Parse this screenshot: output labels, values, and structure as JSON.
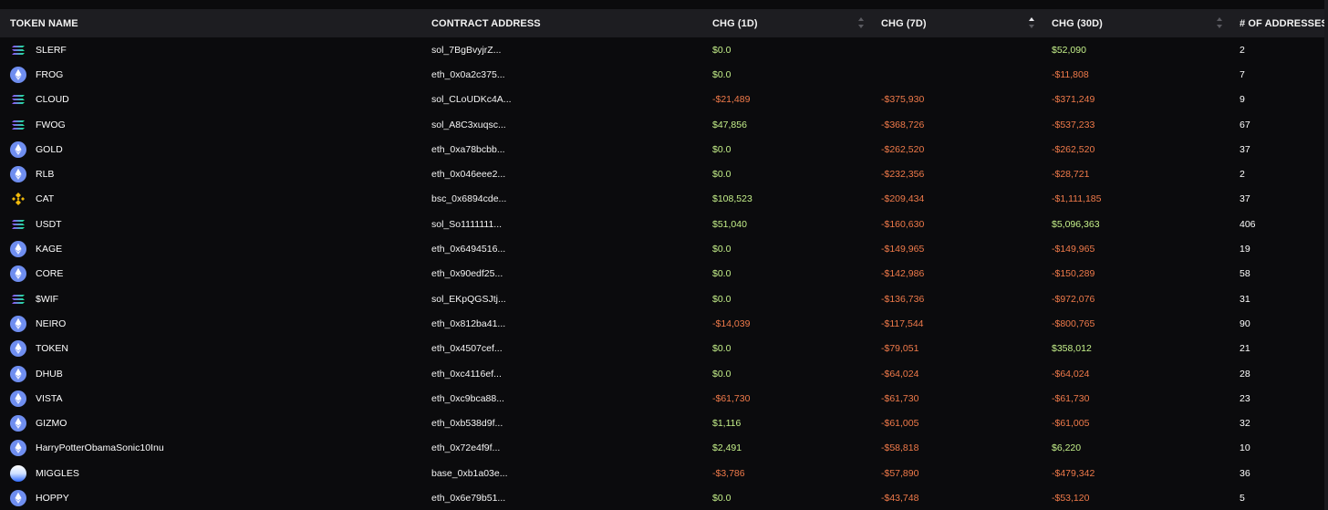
{
  "colors": {
    "background": "#0b0b0d",
    "header_bg": "#1d1d21",
    "positive": "#c5f08a",
    "negative": "#f07a4a",
    "eth_icon": "#6f8ef0",
    "bsc_icon": "#f0b90b"
  },
  "table": {
    "headers": {
      "token_name": "TOKEN NAME",
      "contract_address": "CONTRACT ADDRESS",
      "chg_1d": "CHG (1D)",
      "chg_7d": "CHG (7D)",
      "chg_30d": "CHG (30D)",
      "num_addresses": "# OF ADDRESSES"
    },
    "sort_state": {
      "chg_1d": "none",
      "chg_7d": "ascending",
      "chg_30d": "none"
    },
    "rows": [
      {
        "chain": "sol",
        "icon": "solana-icon",
        "token": "SLERF",
        "address": "sol_7BgBvyjrZ...",
        "chg_1d": "$0.0",
        "d1": "pos",
        "chg_7d": "",
        "d7": "pos",
        "chg_30d": "$52,090",
        "d30": "pos",
        "addresses": "2"
      },
      {
        "chain": "eth",
        "icon": "ethereum-icon",
        "token": "FROG",
        "address": "eth_0x0a2c375...",
        "chg_1d": "$0.0",
        "d1": "pos",
        "chg_7d": "",
        "d7": "pos",
        "chg_30d": "-$11,808",
        "d30": "neg",
        "addresses": "7"
      },
      {
        "chain": "sol",
        "icon": "solana-icon",
        "token": "CLOUD",
        "address": "sol_CLoUDKc4A...",
        "chg_1d": "-$21,489",
        "d1": "neg",
        "chg_7d": "-$375,930",
        "d7": "neg",
        "chg_30d": "-$371,249",
        "d30": "neg",
        "addresses": "9"
      },
      {
        "chain": "sol",
        "icon": "solana-icon",
        "token": "FWOG",
        "address": "sol_A8C3xuqsc...",
        "chg_1d": "$47,856",
        "d1": "pos",
        "chg_7d": "-$368,726",
        "d7": "neg",
        "chg_30d": "-$537,233",
        "d30": "neg",
        "addresses": "67"
      },
      {
        "chain": "eth",
        "icon": "ethereum-icon",
        "token": "GOLD",
        "address": "eth_0xa78bcbb...",
        "chg_1d": "$0.0",
        "d1": "pos",
        "chg_7d": "-$262,520",
        "d7": "neg",
        "chg_30d": "-$262,520",
        "d30": "neg",
        "addresses": "37"
      },
      {
        "chain": "eth",
        "icon": "ethereum-icon",
        "token": "RLB",
        "address": "eth_0x046eee2...",
        "chg_1d": "$0.0",
        "d1": "pos",
        "chg_7d": "-$232,356",
        "d7": "neg",
        "chg_30d": "-$28,721",
        "d30": "neg",
        "addresses": "2"
      },
      {
        "chain": "bsc",
        "icon": "bnb-icon",
        "token": "CAT",
        "address": "bsc_0x6894cde...",
        "chg_1d": "$108,523",
        "d1": "pos",
        "chg_7d": "-$209,434",
        "d7": "neg",
        "chg_30d": "-$1,111,185",
        "d30": "neg",
        "addresses": "37"
      },
      {
        "chain": "sol",
        "icon": "solana-icon",
        "token": "USDT",
        "address": "sol_So1111111...",
        "chg_1d": "$51,040",
        "d1": "pos",
        "chg_7d": "-$160,630",
        "d7": "neg",
        "chg_30d": "$5,096,363",
        "d30": "pos",
        "addresses": "406"
      },
      {
        "chain": "eth",
        "icon": "ethereum-icon",
        "token": "KAGE",
        "address": "eth_0x6494516...",
        "chg_1d": "$0.0",
        "d1": "pos",
        "chg_7d": "-$149,965",
        "d7": "neg",
        "chg_30d": "-$149,965",
        "d30": "neg",
        "addresses": "19"
      },
      {
        "chain": "eth",
        "icon": "ethereum-icon",
        "token": "CORE",
        "address": "eth_0x90edf25...",
        "chg_1d": "$0.0",
        "d1": "pos",
        "chg_7d": "-$142,986",
        "d7": "neg",
        "chg_30d": "-$150,289",
        "d30": "neg",
        "addresses": "58"
      },
      {
        "chain": "sol",
        "icon": "solana-icon",
        "token": "$WIF",
        "address": "sol_EKpQGSJtj...",
        "chg_1d": "$0.0",
        "d1": "pos",
        "chg_7d": "-$136,736",
        "d7": "neg",
        "chg_30d": "-$972,076",
        "d30": "neg",
        "addresses": "31"
      },
      {
        "chain": "eth",
        "icon": "ethereum-icon",
        "token": "NEIRO",
        "address": "eth_0x812ba41...",
        "chg_1d": "-$14,039",
        "d1": "neg",
        "chg_7d": "-$117,544",
        "d7": "neg",
        "chg_30d": "-$800,765",
        "d30": "neg",
        "addresses": "90"
      },
      {
        "chain": "eth",
        "icon": "ethereum-icon",
        "token": "TOKEN",
        "address": "eth_0x4507cef...",
        "chg_1d": "$0.0",
        "d1": "pos",
        "chg_7d": "-$79,051",
        "d7": "neg",
        "chg_30d": "$358,012",
        "d30": "pos",
        "addresses": "21"
      },
      {
        "chain": "eth",
        "icon": "ethereum-icon",
        "token": "DHUB",
        "address": "eth_0xc4116ef...",
        "chg_1d": "$0.0",
        "d1": "pos",
        "chg_7d": "-$64,024",
        "d7": "neg",
        "chg_30d": "-$64,024",
        "d30": "neg",
        "addresses": "28"
      },
      {
        "chain": "eth",
        "icon": "ethereum-icon",
        "token": "VISTA",
        "address": "eth_0xc9bca88...",
        "chg_1d": "-$61,730",
        "d1": "neg",
        "chg_7d": "-$61,730",
        "d7": "neg",
        "chg_30d": "-$61,730",
        "d30": "neg",
        "addresses": "23"
      },
      {
        "chain": "eth",
        "icon": "ethereum-icon",
        "token": "GIZMO",
        "address": "eth_0xb538d9f...",
        "chg_1d": "$1,116",
        "d1": "pos",
        "chg_7d": "-$61,005",
        "d7": "neg",
        "chg_30d": "-$61,005",
        "d30": "neg",
        "addresses": "32"
      },
      {
        "chain": "eth",
        "icon": "ethereum-icon",
        "token": "HarryPotterObamaSonic10Inu",
        "address": "eth_0x72e4f9f...",
        "chg_1d": "$2,491",
        "d1": "pos",
        "chg_7d": "-$58,818",
        "d7": "neg",
        "chg_30d": "$6,220",
        "d30": "pos",
        "addresses": "10"
      },
      {
        "chain": "base",
        "icon": "base-icon",
        "token": "MIGGLES",
        "address": "base_0xb1a03e...",
        "chg_1d": "-$3,786",
        "d1": "neg",
        "chg_7d": "-$57,890",
        "d7": "neg",
        "chg_30d": "-$479,342",
        "d30": "neg",
        "addresses": "36"
      },
      {
        "chain": "eth",
        "icon": "ethereum-icon",
        "token": "HOPPY",
        "address": "eth_0x6e79b51...",
        "chg_1d": "$0.0",
        "d1": "pos",
        "chg_7d": "-$43,748",
        "d7": "neg",
        "chg_30d": "-$53,120",
        "d30": "neg",
        "addresses": "5"
      }
    ]
  }
}
